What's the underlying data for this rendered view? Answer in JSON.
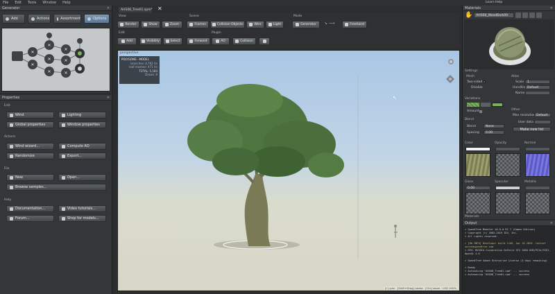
{
  "menu": [
    "File",
    "Edit",
    "Tools",
    "Window",
    "Help"
  ],
  "generator": {
    "title": "Generator",
    "modes": [
      "Add",
      "Actions",
      "Assortment",
      "Options"
    ]
  },
  "properties": {
    "title": "Properties",
    "edit_label": "Edit",
    "edit_buttons": [
      "Wind",
      "Lighting",
      "Global properties",
      "Window properties"
    ],
    "actions_label": "Actions",
    "action_buttons": [
      "Wind wizard...",
      "Compute AO",
      "Randomize",
      "Export..."
    ],
    "file_label": "File",
    "file_buttons": [
      "New",
      "Open...",
      "Browse samples..."
    ],
    "help_label": "Help",
    "help_buttons": [
      "Documentation...",
      "Video tutorials...",
      "Forum...",
      "Shop for models..."
    ]
  },
  "document": {
    "tab": "AHS08_Tree01.spm*",
    "close": "✕",
    "learn_help": "Learn Help"
  },
  "toolbar": {
    "view_label": "View",
    "view_buttons": [
      "Render",
      "Show",
      "Zoom"
    ],
    "scene_label": "Scene",
    "scene_buttons": [
      "Frames",
      "Collision Objects",
      "Wire",
      "Light"
    ],
    "mode_label": "Mode",
    "mode_buttons": [
      "Generator",
      "Freehand"
    ],
    "edit_label": "Edit",
    "edit_buttons": [
      "Add",
      "Visibility",
      "Select",
      "Forward"
    ],
    "plugin_label": "Plugin",
    "plugin_buttons": [
      "AO",
      "Collision"
    ]
  },
  "viewport": {
    "label": "perspective",
    "stats_title": "POLYGONS - MODEL",
    "stats": [
      "branches: 4,762 t/s",
      "leaf meshes: 471 t/s",
      "TOTAL: 5,184",
      "Draws: 8"
    ],
    "status": "[+] pan · [Shift+Drag] rotate · [Ctrl] zoom · LOD 100%"
  },
  "material": {
    "title": "Materials",
    "thumb_select": "AHS08_WoodBark00",
    "settings_label": "Settings",
    "atlas_label": "Atlas",
    "mesh_label": "Mesh",
    "two_sided": "Two-sided",
    "disable": "Disable",
    "scale_label": "Scale",
    "scale_value": "1",
    "handling_label": "Handling",
    "handling_value": "Default",
    "name_label": "Name",
    "variations_label": "Variations",
    "amount_label": "Amount",
    "other_label": "Other",
    "max_resolution_label": "Max resolution",
    "max_resolution_value": "Default",
    "user_data_label": "User data",
    "make_new_label": "Make new list",
    "blend_label": "Blend",
    "blend_mode_label": "Blend",
    "blend_mode_value": "None",
    "spacing_label": "Spacing",
    "spacing_value": "0.00",
    "color_label": "Color",
    "opacity_label": "Opacity",
    "normal_label": "Normal",
    "gloss_label": "Gloss",
    "gloss_value": "0.00",
    "specular_label": "Specular",
    "metallic_label": "Metallic",
    "materials_label": "Materials",
    "variation_color": "#7bb35a"
  },
  "output": {
    "title": "Output",
    "lines": [
      "> SpeedTree Modeler v8.0.0 RC 7 (Games Edition)",
      "> Copyright (c) 2002-2019 IDV, Inc.",
      "> All rights reserved.",
      "",
      "> [HW INFO] Developer build 1106, Apr 10 2020. Contact sales@speedtree.com",
      "> GPU: NVIDIA Corporation GeForce GTX 1060 6GB/PCIe/SSE2, OpenGL 4.6",
      "",
      "> SpeedTree Games Enterprise License (4 days remaining)",
      "",
      "> Ready",
      "> Autosaving \"AHS08_Tree01.spm\" ... success",
      "> Autosaving \"AHS08_Tree01.spm\" ... success"
    ]
  }
}
